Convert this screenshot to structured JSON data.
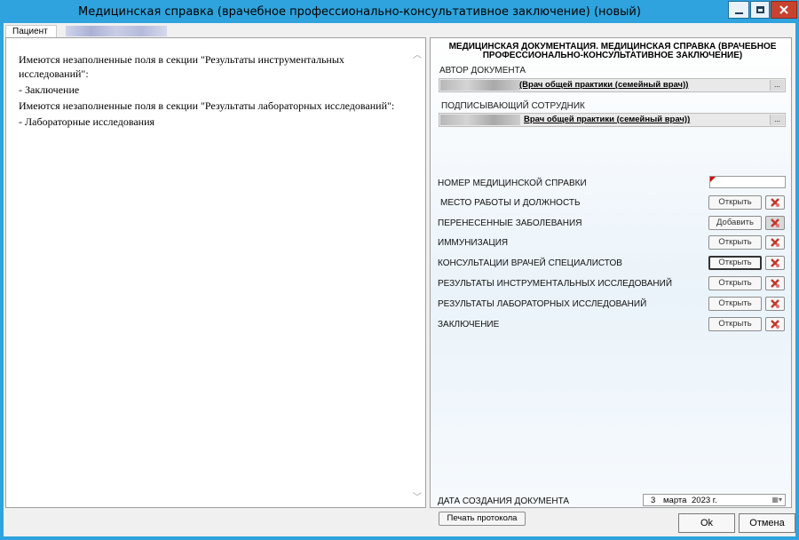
{
  "window": {
    "title": "Медицинская справка (врачебное профессионально-консультативное заключение) (новый)"
  },
  "patient_tab": {
    "label": "Пациент"
  },
  "messages": [
    "Имеются незаполненные поля в секции \"Результаты инструментальных исследований\":",
    "- Заключение",
    "Имеются незаполненные поля в секции \"Результаты лабораторных исследований\":",
    "- Лабораторные исследования"
  ],
  "doc": {
    "title": "МЕДИЦИНСКАЯ ДОКУМЕНТАЦИЯ. МЕДИЦИНСКАЯ СПРАВКА (ВРАЧЕБНОЕ ПРОФЕССИОНАЛЬНО-КОНСУЛЬТАТИВНОЕ ЗАКЛЮЧЕНИЕ)",
    "author_label": "АВТОР ДОКУМЕНТА",
    "author_value": "(Врач общей практики (семейный врач))",
    "signer_label": "ПОДПИСЫВАЮЩИЙ СОТРУДНИК",
    "signer_value": "Врач общей практики (семейный врач))",
    "ellipsis": "...",
    "number_label": "НОМЕР МЕДИЦИНСКОЙ СПРАВКИ"
  },
  "sections": [
    {
      "label": "МЕСТО РАБОТЫ И ДОЛЖНОСТЬ",
      "button": "Открыть"
    },
    {
      "label": "ПЕРЕНЕСЕННЫЕ ЗАБОЛЕВАНИЯ",
      "button": "Добавить"
    },
    {
      "label": "ИММУНИЗАЦИЯ",
      "button": "Открыть"
    },
    {
      "label": "КОНСУЛЬТАЦИИ ВРАЧЕЙ СПЕЦИАЛИСТОВ",
      "button": "Открыть"
    },
    {
      "label": "РЕЗУЛЬТАТЫ ИНСТРУМЕНТАЛЬНЫХ ИССЛЕДОВАНИЙ",
      "button": "Открыть"
    },
    {
      "label": "РЕЗУЛЬТАТЫ ЛАБОРАТОРНЫХ ИССЛЕДОВАНИЙ",
      "button": "Открыть"
    },
    {
      "label": "ЗАКЛЮЧЕНИЕ",
      "button": "Открыть"
    }
  ],
  "date": {
    "label": "ДАТА СОЗДАНИЯ ДОКУМЕНТА",
    "day": "3",
    "month": "марта",
    "year": "2023 г."
  },
  "print_button": "Печать протокола",
  "footer": {
    "ok": "Ok",
    "cancel": "Отмена"
  },
  "colors": {
    "frame": "#2ea3dd",
    "close": "#c7432f",
    "delete_icon": "#c0392b"
  }
}
